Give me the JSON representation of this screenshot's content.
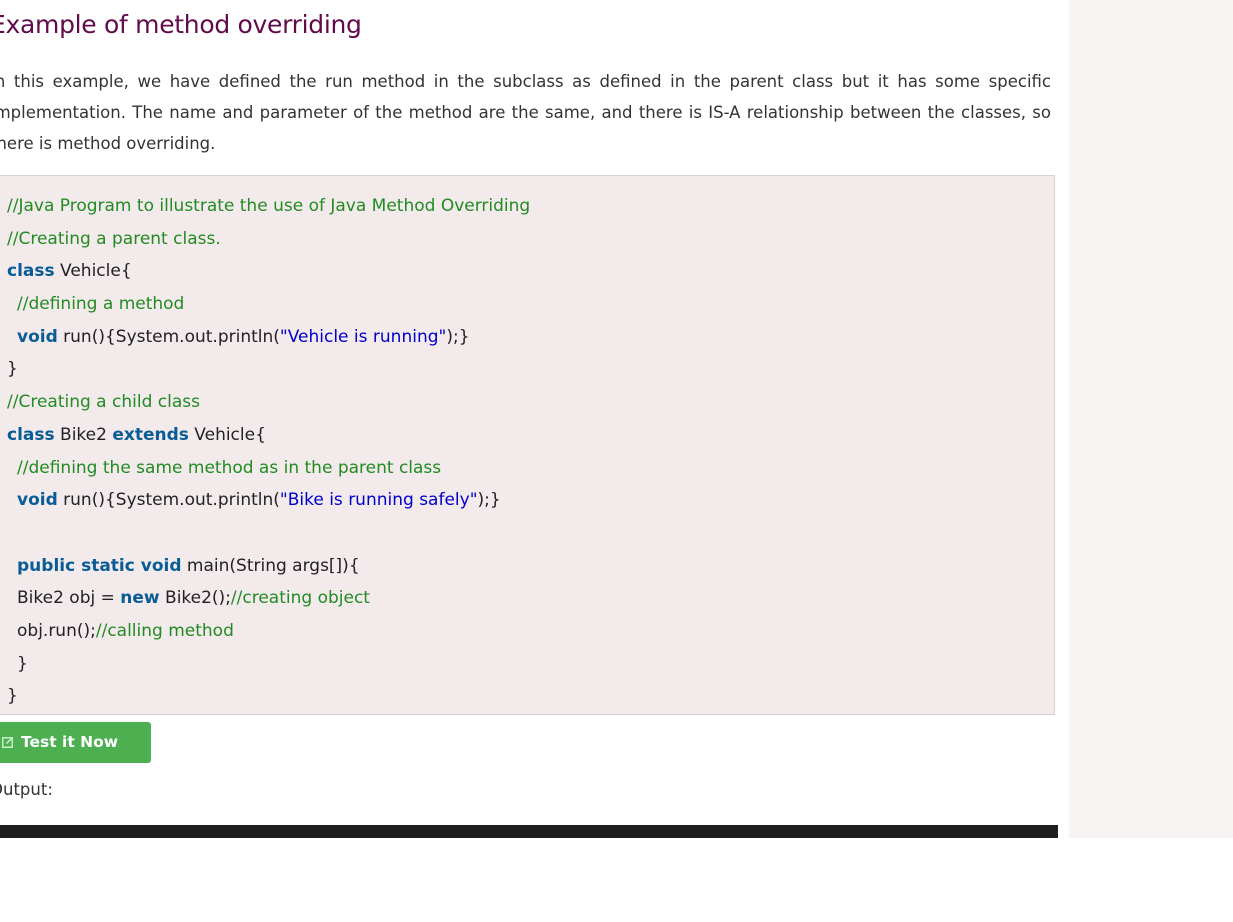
{
  "heading": "Example of method overriding",
  "intro": "In this example, we have defined the run method in the subclass as defined in the parent class but it has some specific implementation. The name and parameter of the method are the same, and there is IS-A relationship between the classes, so there is method overriding.",
  "code": {
    "c1": "//Java Program to illustrate the use of Java Method Overriding",
    "c2": "//Creating a parent class.",
    "l3_kw": "class",
    "l3_txt": " Vehicle{",
    "c4": "//defining a method",
    "l5_kw": "void",
    "l5_a": " run(){System.out.println(",
    "l5_str": "\"Vehicle is running\"",
    "l5_b": ");}",
    "l6": "}",
    "c7": "//Creating a child class",
    "l8_kw1": "class",
    "l8_a": " Bike2 ",
    "l8_kw2": "extends",
    "l8_b": " Vehicle{",
    "c9": "//defining the same method as in the parent class",
    "l10_kw": "void",
    "l10_a": " run(){System.out.println(",
    "l10_str": "\"Bike is running safely\"",
    "l10_b": ");}",
    "l12_kw": "public static void",
    "l12_a": " main(String args[]){",
    "l13_a": "Bike2 obj = ",
    "l13_kw": "new",
    "l13_b": " Bike2();",
    "l13_cm": "//creating object",
    "l14_a": "obj.run();",
    "l14_cm": "//calling method",
    "l15": "}",
    "l16": "}"
  },
  "test_button": {
    "label": "Test it Now",
    "icon": "edit-icon"
  },
  "output_label": "Output:",
  "colors": {
    "heading": "#610b4b",
    "keyword": "#0a5c96",
    "comment": "#228b22",
    "string": "#0000cc",
    "button": "#4caf50",
    "code_bg": "#f2eaeb"
  }
}
